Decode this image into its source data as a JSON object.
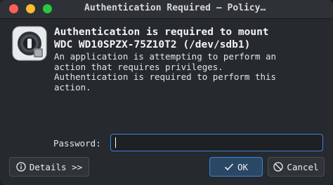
{
  "window": {
    "title": "Authentication Required — Policy…"
  },
  "dialog": {
    "heading_line1": "Authentication is required to mount",
    "heading_line2": "WDC WD10SPZX-75Z10T2 (/dev/sdb1)",
    "desc_line1": "An application is attempting to perform an",
    "desc_line2": "action that requires privileges.",
    "desc_line3": "Authentication is required to perform this",
    "desc_line4": "action.",
    "password_label": "Password:",
    "password_value": ""
  },
  "buttons": {
    "details": "Details >>",
    "ok": "OK",
    "cancel": "Cancel"
  },
  "icons": {
    "app": "drive-lock-icon",
    "details": "info-circle-icon",
    "ok": "checkmark-icon",
    "cancel": "no-entry-icon"
  },
  "colors": {
    "window_bg": "#26292d",
    "accent": "#3b84d8",
    "close": "#ff5f57",
    "minimize": "#febc2e",
    "maximize": "#28c840"
  }
}
